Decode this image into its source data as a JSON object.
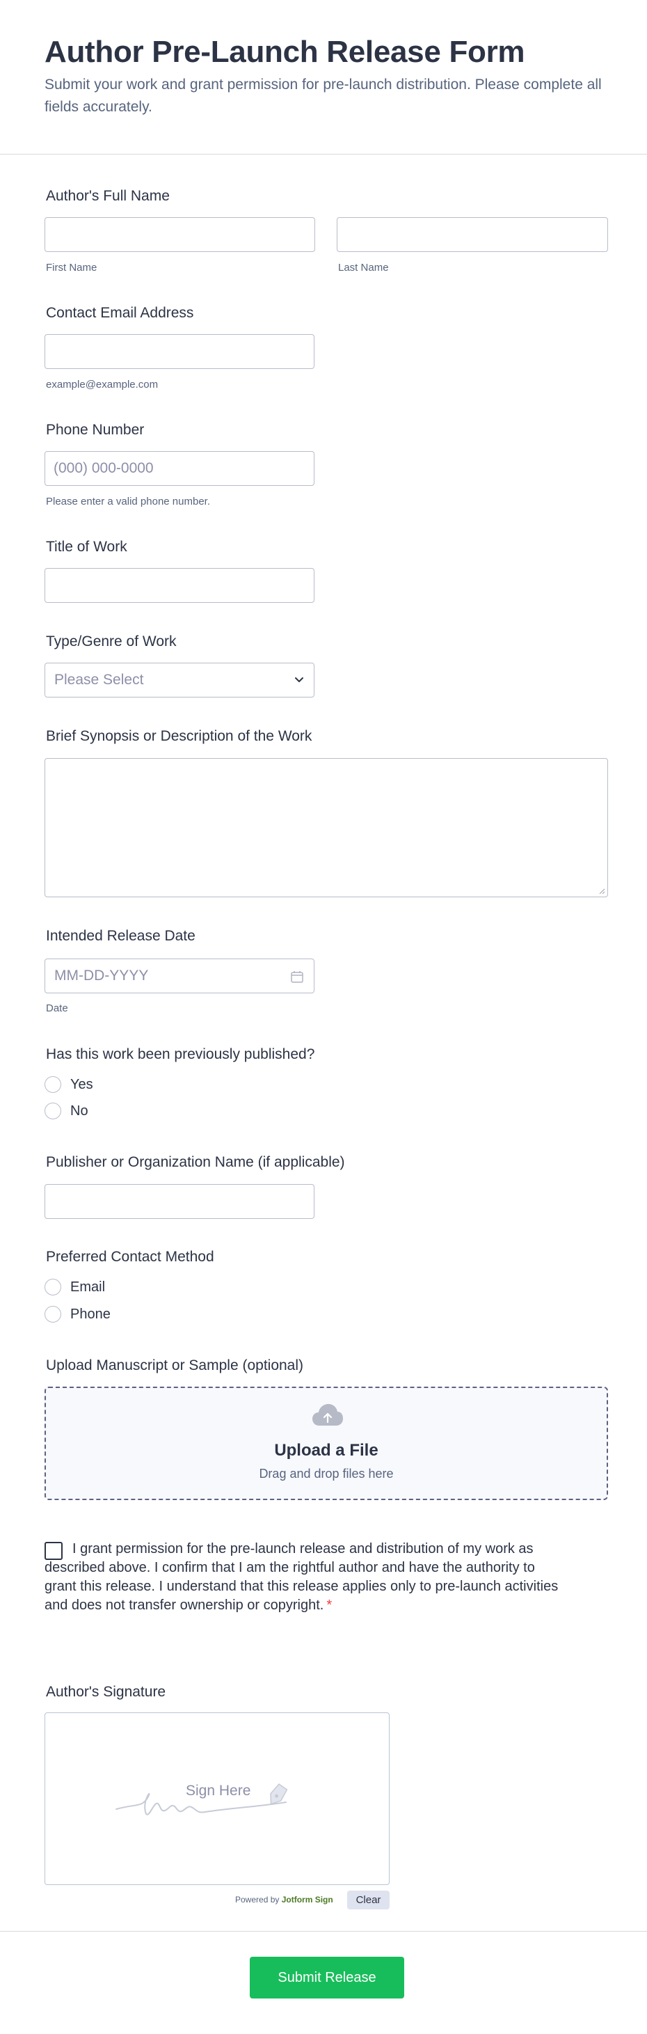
{
  "header": {
    "title": "Author Pre-Launch Release Form",
    "subtitle": "Submit your work and grant permission for pre-launch distribution. Please complete all fields accurately."
  },
  "author_name": {
    "label": "Author's Full Name",
    "first_value": "",
    "last_value": "",
    "first_sublabel": "First Name",
    "last_sublabel": "Last Name"
  },
  "email": {
    "label": "Contact Email Address",
    "value": "",
    "sublabel": "example@example.com"
  },
  "phone": {
    "label": "Phone Number",
    "placeholder": "(000) 000-0000",
    "sublabel": "Please enter a valid phone number."
  },
  "title_of_work": {
    "label": "Title of Work",
    "value": ""
  },
  "genre": {
    "label": "Type/Genre of Work",
    "selected": "Please Select"
  },
  "synopsis": {
    "label": "Brief Synopsis or Description of the Work",
    "value": ""
  },
  "release_date": {
    "label": "Intended Release Date",
    "placeholder": "MM-DD-YYYY",
    "sublabel": "Date"
  },
  "previously_published": {
    "label": "Has this work been previously published?",
    "options": [
      "Yes",
      "No"
    ]
  },
  "publisher": {
    "label": "Publisher or Organization Name (if applicable)",
    "value": ""
  },
  "contact_method": {
    "label": "Preferred Contact Method",
    "options": [
      "Email",
      "Phone"
    ]
  },
  "upload": {
    "label": "Upload Manuscript or Sample (optional)",
    "title": "Upload a File",
    "subtitle": "Drag and drop files here",
    "icon": "cloud-upload-icon"
  },
  "consent": {
    "text": "I grant permission for the pre-launch release and distribution of my work as described above. I confirm that I am the rightful author and have the authority to grant this release. I understand that this release applies only to pre-launch activities and does not transfer ownership or copyright.",
    "required_mark": "*"
  },
  "signature": {
    "label": "Author's Signature",
    "hint": "Sign Here",
    "powered_prefix": "Powered by",
    "powered_brand": "Jotform Sign",
    "clear_label": "Clear"
  },
  "submit": {
    "label": "Submit Release"
  },
  "colors": {
    "submit": "#18bd5b",
    "text": "#2c3345",
    "muted": "#57647e",
    "border": "#b8bdc9",
    "required": "#f23a3c"
  }
}
